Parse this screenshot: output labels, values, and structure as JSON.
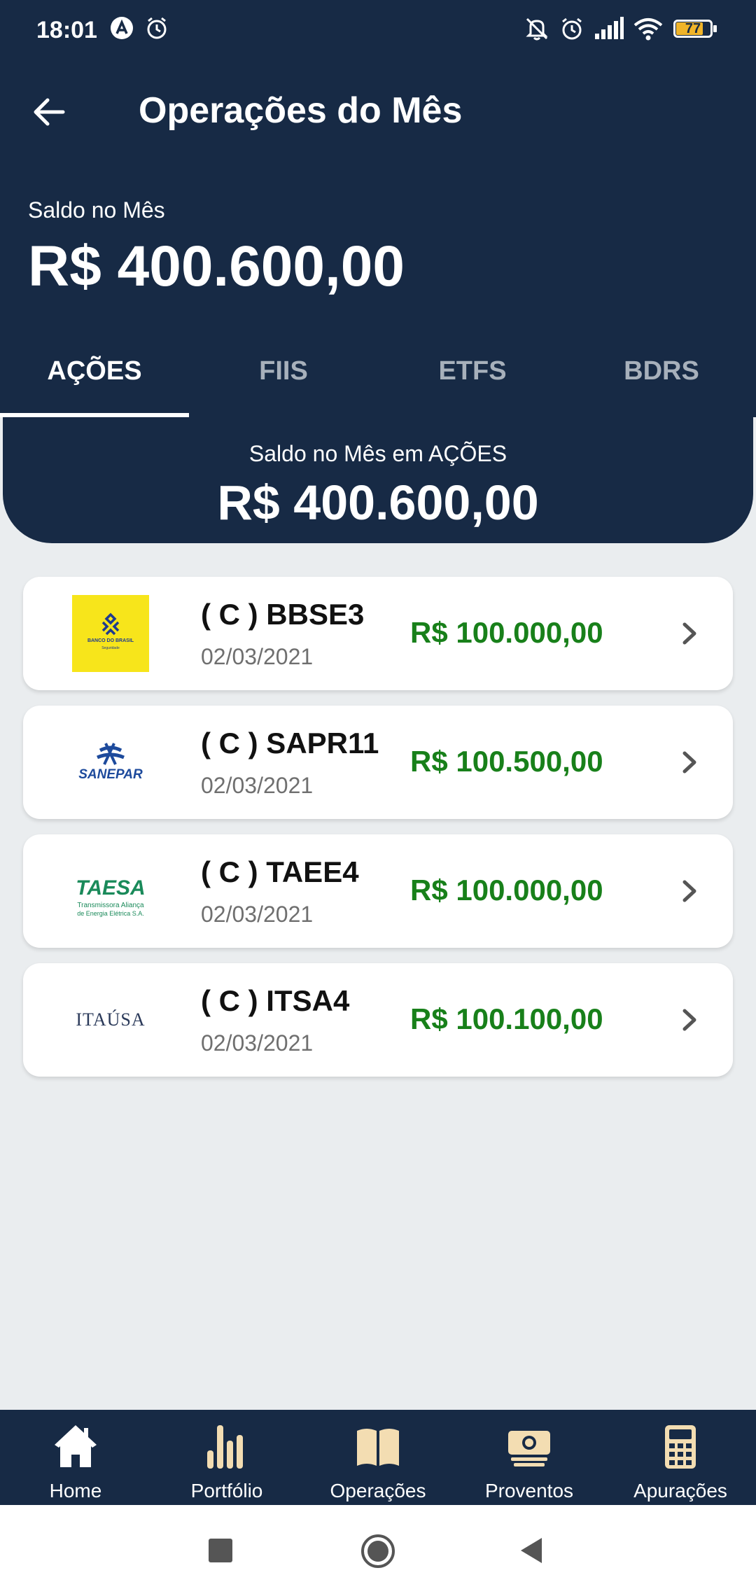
{
  "status_bar": {
    "time": "18:01",
    "battery": "77"
  },
  "appbar": {
    "title": "Operações do Mês"
  },
  "saldo": {
    "label": "Saldo no Mês",
    "value": "R$ 400.600,00"
  },
  "tabs": [
    {
      "label": "AÇÕES",
      "active": true
    },
    {
      "label": "FIIS",
      "active": false
    },
    {
      "label": "ETFS",
      "active": false
    },
    {
      "label": "BDRS",
      "active": false
    }
  ],
  "summary": {
    "label": "Saldo no Mês em AÇÕES",
    "value": "R$ 400.600,00"
  },
  "operations": [
    {
      "title": "( C ) BBSE3",
      "date": "02/03/2021",
      "value": "R$ 100.000,00",
      "logo": {
        "lines": [
          "BANCO DO BRASIL",
          "Seguridade"
        ]
      }
    },
    {
      "title": "( C ) SAPR11",
      "date": "02/03/2021",
      "value": "R$ 100.500,00",
      "logo": {
        "lines": [
          "SANEPAR"
        ]
      }
    },
    {
      "title": "( C ) TAEE4",
      "date": "02/03/2021",
      "value": "R$ 100.000,00",
      "logo": {
        "lines": [
          "TAESA",
          "Transmissora Aliança",
          "de Energia Elétrica S.A."
        ]
      }
    },
    {
      "title": "( C ) ITSA4",
      "date": "02/03/2021",
      "value": "R$ 100.100,00",
      "logo": {
        "lines": [
          "ITAÚSA"
        ]
      }
    }
  ],
  "bottom_nav": [
    {
      "label": "Home",
      "icon": "home-icon"
    },
    {
      "label": "Portfólio",
      "icon": "bar-chart-icon"
    },
    {
      "label": "Operações",
      "icon": "book-icon"
    },
    {
      "label": "Proventos",
      "icon": "money-icon"
    },
    {
      "label": "Apurações",
      "icon": "calculator-icon"
    }
  ],
  "colors": {
    "navy": "#172a45",
    "green": "#18801a",
    "background": "#eaedef",
    "accent_icon": "#f3ddb2"
  }
}
